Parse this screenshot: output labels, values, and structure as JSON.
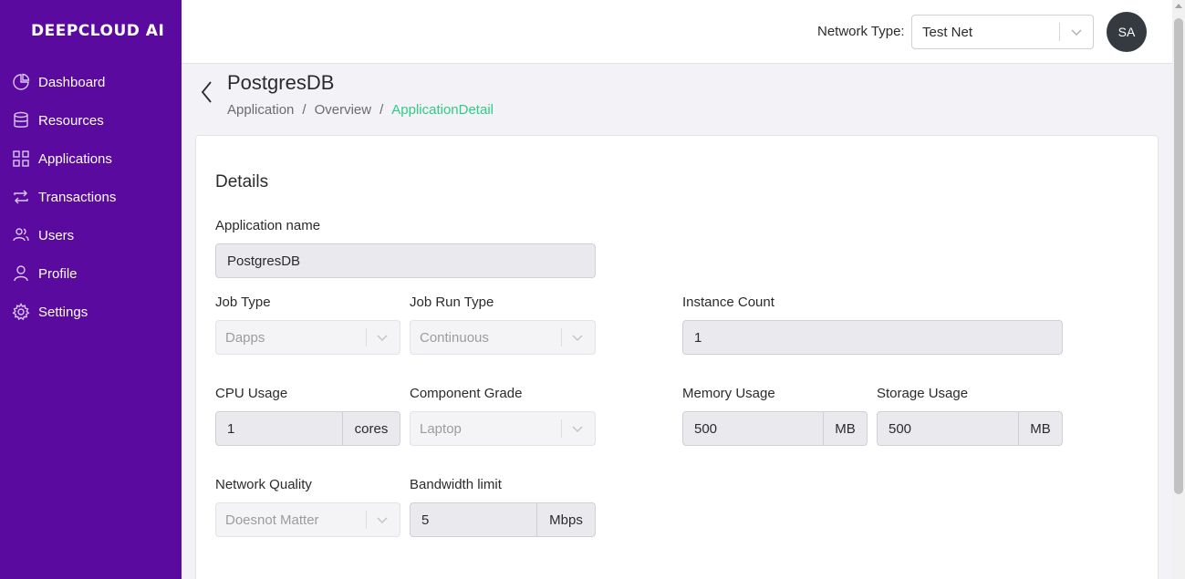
{
  "app": {
    "logo": "DEEPCLOUD AI"
  },
  "sidebar": {
    "items": [
      {
        "label": "Dashboard",
        "icon": "pie-chart-icon"
      },
      {
        "label": "Resources",
        "icon": "database-icon"
      },
      {
        "label": "Applications",
        "icon": "grid-icon"
      },
      {
        "label": "Transactions",
        "icon": "repeat-icon"
      },
      {
        "label": "Users",
        "icon": "users-icon"
      },
      {
        "label": "Profile",
        "icon": "user-icon"
      },
      {
        "label": "Settings",
        "icon": "gear-icon"
      }
    ]
  },
  "header": {
    "network_label": "Network Type:",
    "network_value": "Test Net",
    "avatar_initials": "SA"
  },
  "page": {
    "title": "PostgresDB",
    "breadcrumb": [
      "Application",
      "Overview",
      "ApplicationDetail"
    ]
  },
  "details": {
    "title": "Details",
    "app_name_label": "Application name",
    "app_name_value": "PostgresDB",
    "job_type_label": "Job Type",
    "job_type_value": "Dapps",
    "job_run_type_label": "Job Run Type",
    "job_run_type_value": "Continuous",
    "instance_count_label": "Instance Count",
    "instance_count_value": "1",
    "cpu_label": "CPU Usage",
    "cpu_value": "1",
    "cpu_unit": "cores",
    "component_grade_label": "Component Grade",
    "component_grade_value": "Laptop",
    "memory_label": "Memory Usage",
    "memory_value": "500",
    "memory_unit": "MB",
    "storage_label": "Storage Usage",
    "storage_value": "500",
    "storage_unit": "MB",
    "network_quality_label": "Network Quality",
    "network_quality_value": "Doesnot Matter",
    "bandwidth_label": "Bandwidth limit",
    "bandwidth_value": "5",
    "bandwidth_unit": "Mbps"
  },
  "colors": {
    "sidebar_bg": "#5b0aa0",
    "breadcrumb_active": "#2ecc85",
    "avatar_bg": "#343a40"
  }
}
